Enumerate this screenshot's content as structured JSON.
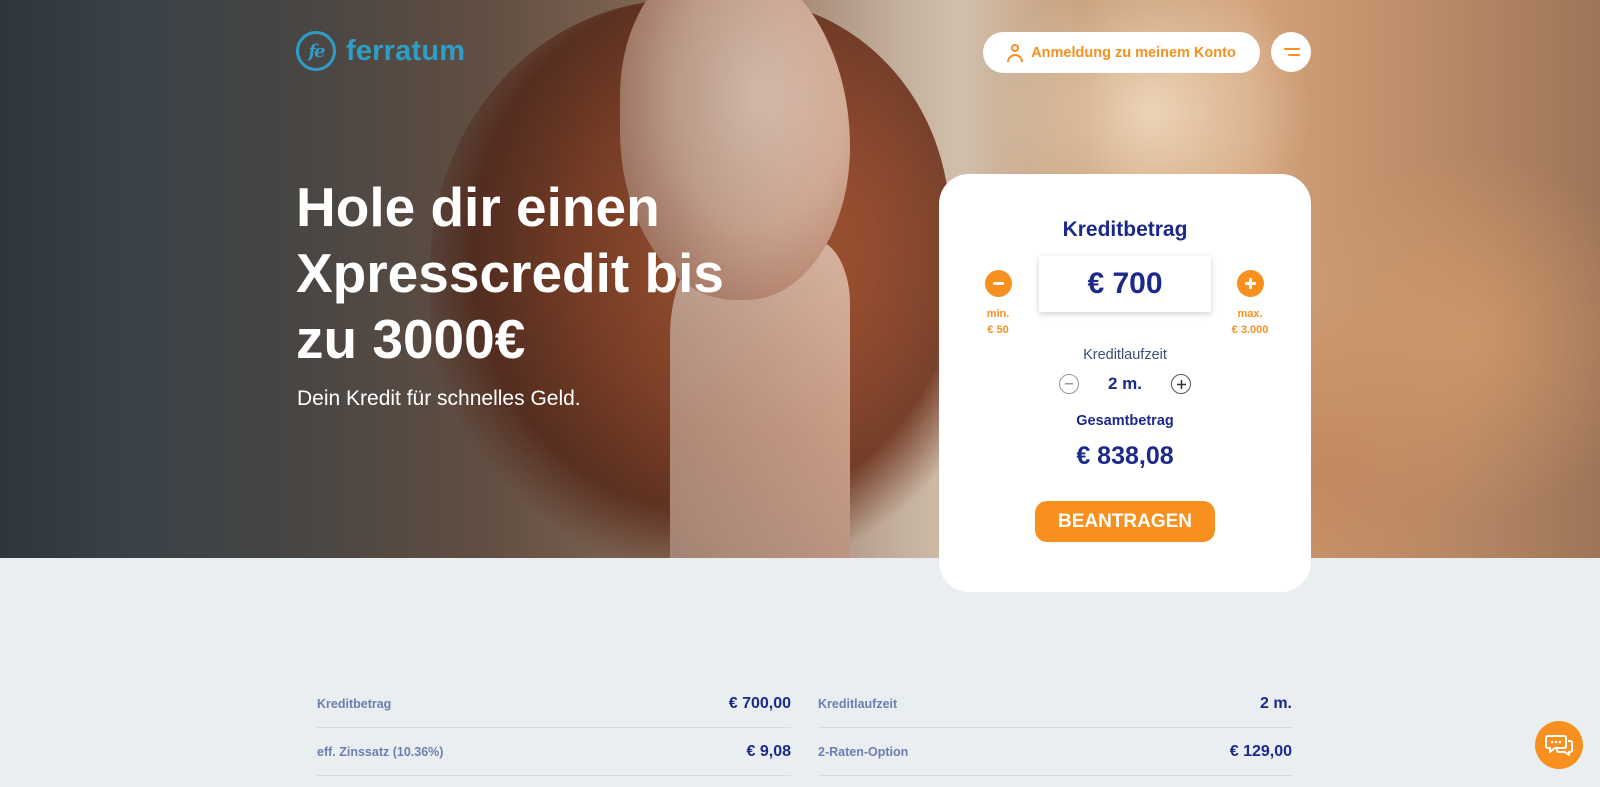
{
  "header": {
    "logo_text": "ferratum",
    "logo_mark": "fe",
    "login_label": "Anmeldung zu meinem Konto"
  },
  "hero": {
    "headline": "Hole dir einen Xpresscredit bis zu 3000€",
    "subline": "Dein Kredit für schnelles Geld."
  },
  "calculator": {
    "title": "Kreditbetrag",
    "amount": "€ 700",
    "min_label": "min.",
    "min_value": "€ 50",
    "max_label": "max.",
    "max_value": "€ 3.000",
    "term_label": "Kreditlaufzeit",
    "term_value": "2 m.",
    "total_label": "Gesamtbetrag",
    "total_value": "€ 838,08",
    "apply_label": "BEANTRAGEN"
  },
  "details": [
    {
      "label": "Kreditbetrag",
      "value": "€ 700,00"
    },
    {
      "label": "Kreditlaufzeit",
      "value": "2 m."
    },
    {
      "label": "eff. Zinssatz (10.36%)",
      "value": "€ 9,08"
    },
    {
      "label": "2-Raten-Option",
      "value": "€ 129,00"
    }
  ],
  "colors": {
    "accent": "#f7901e",
    "brand": "#2e9ec7",
    "navy": "#1b2a8a",
    "page_background": "#e9eef0"
  },
  "icons": {
    "user": "user-icon",
    "menu": "menu-icon",
    "minus": "minus-icon",
    "plus": "plus-icon",
    "chat": "chat-icon"
  }
}
